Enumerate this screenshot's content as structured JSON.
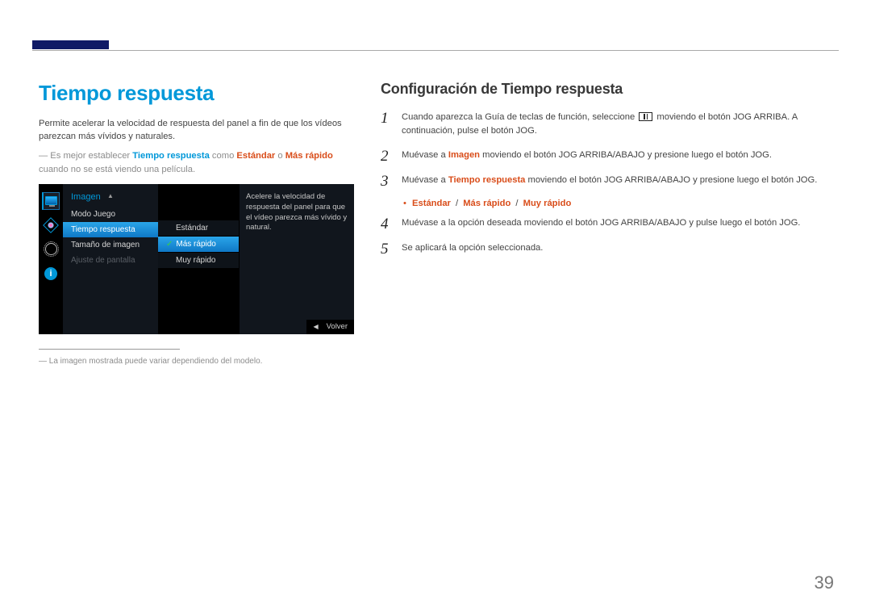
{
  "left": {
    "title": "Tiempo respuesta",
    "intro": "Permite acelerar la velocidad de respuesta del panel a fin de que los vídeos parezcan más vívidos y naturales.",
    "note_pre": "― Es mejor establecer ",
    "note_b1": "Tiempo respuesta",
    "note_mid1": " como ",
    "note_b2": "Estándar",
    "note_mid2": " o ",
    "note_b3": "Más rápido",
    "note_post": " cuando no se está viendo una película.",
    "osd": {
      "menu_title": "Imagen",
      "items": {
        "modo_juego": "Modo Juego",
        "tiempo_respuesta": "Tiempo respuesta",
        "tamano_imagen": "Tamaño de imagen",
        "ajuste_pantalla": "Ajuste de pantalla"
      },
      "sub": {
        "estandar": "Estándar",
        "mas_rapido": "Más rápido",
        "muy_rapido": "Muy rápido"
      },
      "desc": "Acelere la velocidad de respuesta del panel para que el vídeo parezca más vívido y natural.",
      "volver": "Volver"
    },
    "foot_note": "― La imagen mostrada puede variar dependiendo del modelo."
  },
  "right": {
    "title": "Configuración de Tiempo respuesta",
    "steps": {
      "s1a": "Cuando aparezca la Guía de teclas de función, seleccione ",
      "s1b": " moviendo el botón JOG ARRIBA. A continuación, pulse el botón JOG.",
      "s2a": "Muévase a ",
      "s2b": "Imagen",
      "s2c": " moviendo el botón JOG ARRIBA/ABAJO y presione luego el botón JOG.",
      "s3a": "Muévase a ",
      "s3b": "Tiempo respuesta",
      "s3c": " moviendo el botón JOG ARRIBA/ABAJO y presione luego el botón JOG.",
      "opts": {
        "o1": "Estándar",
        "o2": "Más rápido",
        "o3": "Muy rápido"
      },
      "s4": "Muévase a la opción deseada moviendo el botón JOG ARRIBA/ABAJO y pulse luego el botón JOG.",
      "s5": "Se aplicará la opción seleccionada."
    }
  },
  "page_number": "39"
}
